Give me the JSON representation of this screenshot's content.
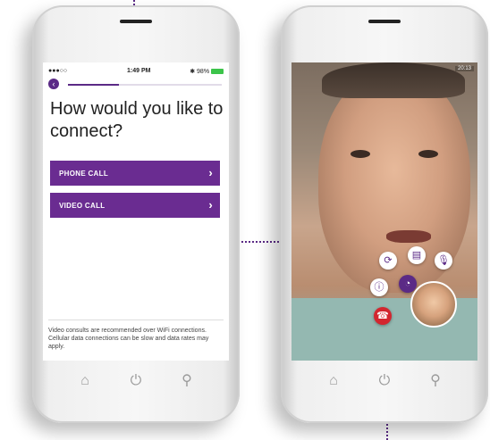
{
  "left_phone": {
    "status": {
      "carrier": "●●●○○",
      "time": "1:49 PM",
      "battery": "✱ 98%"
    },
    "progress_value": 0.33,
    "heading": "How would you like to connect?",
    "options": [
      {
        "label": "PHONE CALL"
      },
      {
        "label": "VIDEO CALL"
      }
    ],
    "note": "Video consults are recommended over WiFi connections. Cellular data connections can be slow and data rates may apply."
  },
  "right_phone": {
    "status_time": "20:13"
  },
  "icons": {
    "back": "chevron-left-icon",
    "option_chevron": "chevron-right-icon",
    "home": "home-icon",
    "power": "power-icon",
    "search": "search-icon",
    "switch_camera": "refresh-icon",
    "document": "document-icon",
    "mic": "microphone-icon",
    "info": "info-icon",
    "timer": "clock-icon",
    "end_call": "phone-hangup-icon"
  },
  "colors": {
    "brand_purple": "#6a2c91",
    "end_call_red": "#d3262f",
    "battery_green": "#3cc44a"
  }
}
